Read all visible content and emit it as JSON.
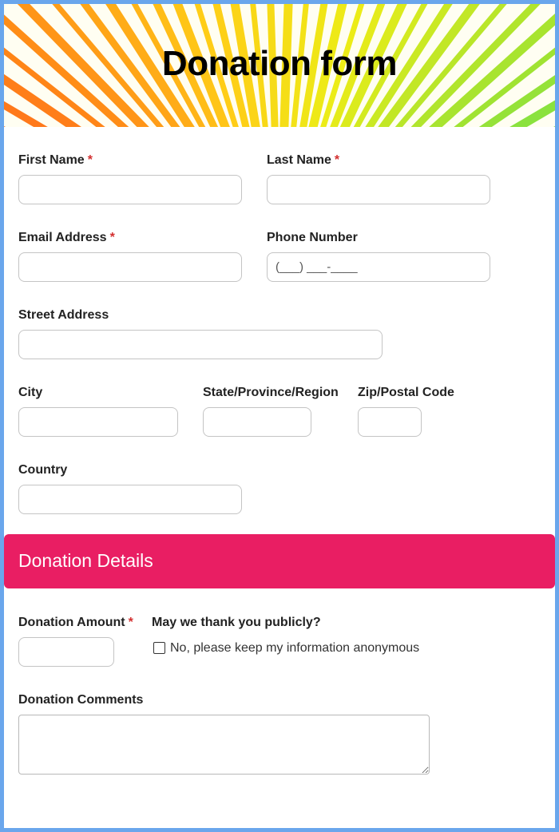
{
  "header": {
    "title": "Donation form"
  },
  "required_marker": "*",
  "fields": {
    "first_name": {
      "label": "First Name"
    },
    "last_name": {
      "label": "Last Name"
    },
    "email": {
      "label": "Email Address"
    },
    "phone": {
      "label": "Phone Number",
      "placeholder": "(___) ___-____"
    },
    "street": {
      "label": "Street Address"
    },
    "city": {
      "label": "City"
    },
    "state": {
      "label": "State/Province/Region"
    },
    "zip": {
      "label": "Zip/Postal Code"
    },
    "country": {
      "label": "Country"
    }
  },
  "donation": {
    "section_title": "Donation Details",
    "amount_label": "Donation Amount",
    "thank_label": "May we thank you publicly?",
    "anonymous_option": "No, please keep my information anonymous",
    "anonymous_checked": false,
    "comments_label": "Donation Comments"
  },
  "colors": {
    "accent": "#e91e63",
    "page_border": "#6aa6ec",
    "required": "#d32f2f"
  }
}
